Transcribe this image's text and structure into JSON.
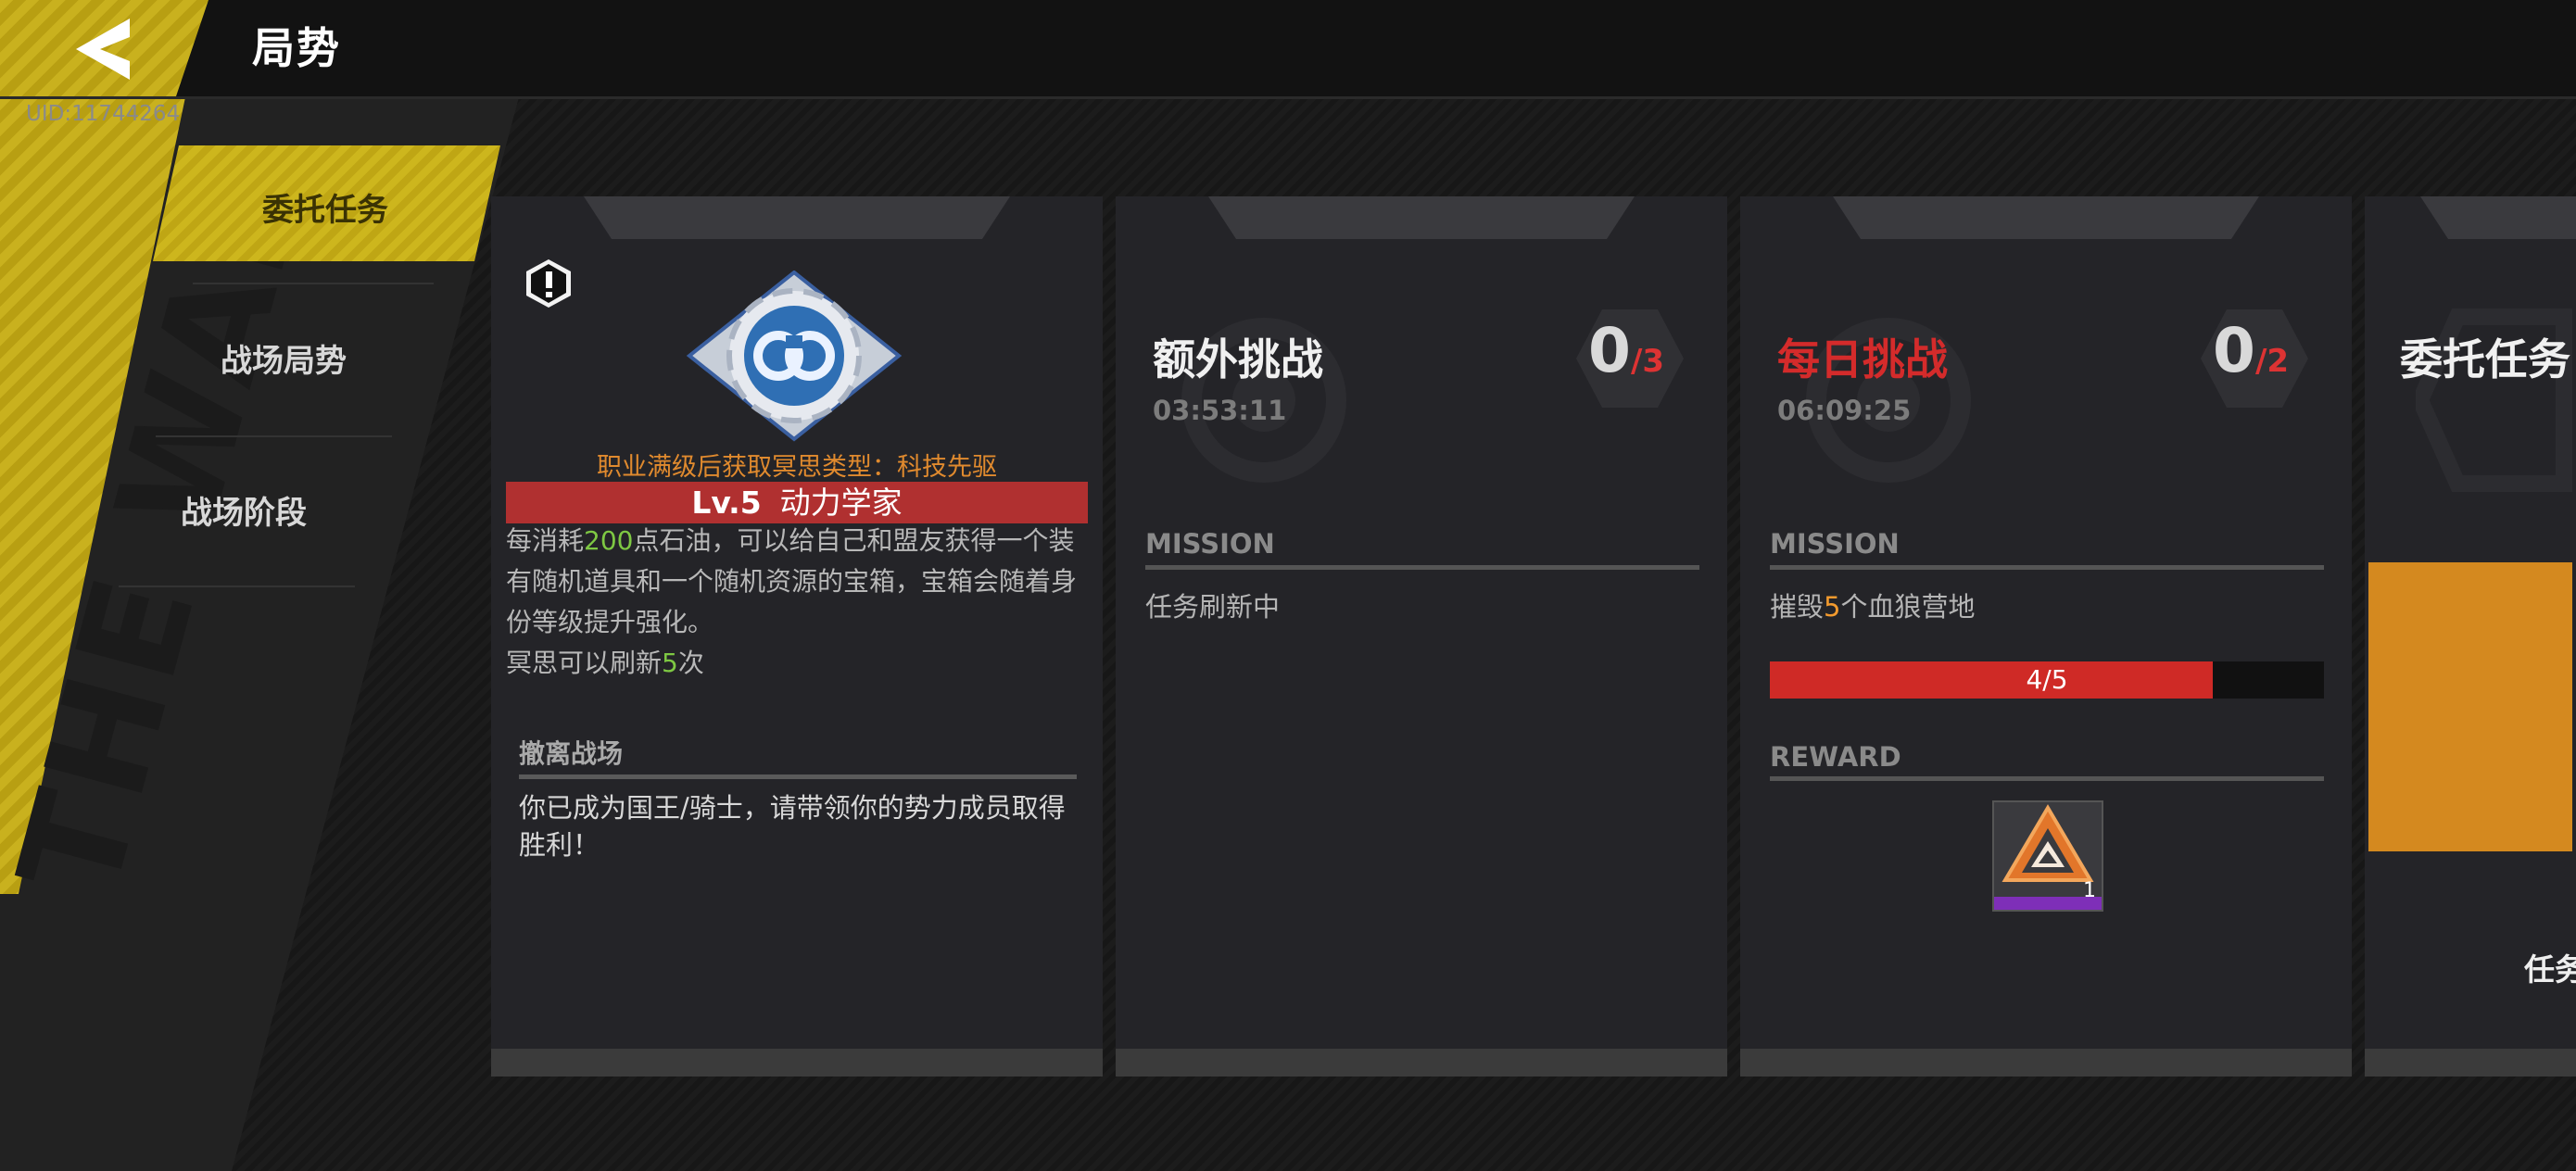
{
  "header": {
    "title": "局势",
    "uid": "UID:11744264"
  },
  "sidebar": {
    "items": [
      {
        "label": "委托任务",
        "active": true
      },
      {
        "label": "战场局势",
        "active": false
      },
      {
        "label": "战场阶段",
        "active": false
      }
    ]
  },
  "decor": {
    "banner_text": "THE WAR"
  },
  "cards": {
    "profession": {
      "class_hint": "职业满级后获取冥思类型：科技先驱",
      "level": "Lv.5",
      "class_name": "动力学家",
      "desc_line1_a": "每消耗",
      "desc_line1_num": "200",
      "desc_line1_b": "点石油，可以给自己和盟友获得一个装有随机道具和一个随机资源的宝箱，宝箱会随着身份等级提升强化。",
      "desc_line2_a": "冥思可以刷新",
      "desc_line2_num": "5",
      "desc_line2_b": "次",
      "withdraw_title": "撤离战场",
      "withdraw_text": "你已成为国王/骑士，请带领你的势力成员取得胜利！"
    },
    "extra": {
      "title": "额外挑战",
      "timer": "03:53:11",
      "count": "0",
      "total": "/3",
      "mission_label": "MISSION",
      "mission_text": "任务刷新中"
    },
    "daily": {
      "title": "每日挑战",
      "timer": "06:09:25",
      "count": "0",
      "total": "/2",
      "mission_label": "MISSION",
      "mission_a": "摧毁",
      "mission_num": "5",
      "mission_b": "个血狼营地",
      "progress_text": "4/5",
      "progress_value": 0.8,
      "reward_label": "REWARD",
      "reward_qty": "1"
    },
    "commission": {
      "title": "委托任务",
      "partial_text": "任务"
    }
  },
  "colors": {
    "accent_yellow": "#c9b11e",
    "daily_red": "#d42b2b",
    "progress_red": "#cf2a26",
    "highlight_orange": "#f29a2e",
    "highlight_green": "#7ec843"
  }
}
